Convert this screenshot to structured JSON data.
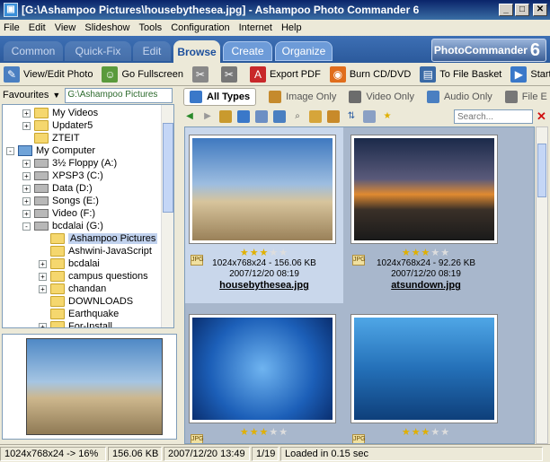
{
  "window": {
    "title": "[G:\\Ashampoo Pictures\\housebythesea.jpg] - Ashampoo Photo Commander 6",
    "minimize_glyph": "_",
    "maximize_glyph": "□",
    "close_glyph": "✕"
  },
  "menu": [
    "File",
    "Edit",
    "View",
    "Slideshow",
    "Tools",
    "Configuration",
    "Internet",
    "Help"
  ],
  "mode_tabs": [
    "Common",
    "Quick-Fix",
    "Edit",
    "Browse",
    "Create",
    "Organize"
  ],
  "brand": {
    "line1": "Ashampoo",
    "line2": "PhotoCommander",
    "version": "6"
  },
  "toolbar": {
    "view_edit": "View/Edit Photo",
    "fullscreen": "Go Fullscreen",
    "export_pdf": "Export PDF",
    "burn": "Burn CD/DVD",
    "file_basket": "To File Basket",
    "slideshow": "Start SlideSh"
  },
  "favourites": {
    "label": "Favourites",
    "path": "G:\\Ashampoo Pictures"
  },
  "tree": [
    {
      "label": "My Videos",
      "indent": 2,
      "expander": "+",
      "icon": "folder"
    },
    {
      "label": "Updater5",
      "indent": 2,
      "expander": "+",
      "icon": "folder"
    },
    {
      "label": "ZTEIT",
      "indent": 2,
      "expander": "",
      "icon": "folder"
    },
    {
      "label": "My Computer",
      "indent": 1,
      "expander": "-",
      "icon": "computer"
    },
    {
      "label": "3½ Floppy (A:)",
      "indent": 2,
      "expander": "+",
      "icon": "drive"
    },
    {
      "label": "XPSP3 (C:)",
      "indent": 2,
      "expander": "+",
      "icon": "drive"
    },
    {
      "label": "Data (D:)",
      "indent": 2,
      "expander": "+",
      "icon": "drive"
    },
    {
      "label": "Songs (E:)",
      "indent": 2,
      "expander": "+",
      "icon": "drive"
    },
    {
      "label": "Video (F:)",
      "indent": 2,
      "expander": "+",
      "icon": "drive"
    },
    {
      "label": "bcdalai (G:)",
      "indent": 2,
      "expander": "-",
      "icon": "drive"
    },
    {
      "label": "Ashampoo Pictures",
      "indent": 3,
      "expander": "",
      "icon": "folder",
      "selected": true
    },
    {
      "label": "Ashwini-JavaScript",
      "indent": 3,
      "expander": "",
      "icon": "folder"
    },
    {
      "label": "bcdalai",
      "indent": 3,
      "expander": "+",
      "icon": "folder"
    },
    {
      "label": "campus questions",
      "indent": 3,
      "expander": "+",
      "icon": "folder"
    },
    {
      "label": "chandan",
      "indent": 3,
      "expander": "+",
      "icon": "folder"
    },
    {
      "label": "DOWNLOADS",
      "indent": 3,
      "expander": "",
      "icon": "folder"
    },
    {
      "label": "Earthquake",
      "indent": 3,
      "expander": "",
      "icon": "folder"
    },
    {
      "label": "For-Install",
      "indent": 3,
      "expander": "+",
      "icon": "folder"
    }
  ],
  "filters": [
    "All Types",
    "Image Only",
    "Video Only",
    "Audio Only",
    "File E"
  ],
  "search": {
    "placeholder": "Search..."
  },
  "thumbnails": [
    {
      "dims": "1024x768x24 - 156.06 KB",
      "date": "2007/12/20 08:19",
      "name": "housebythesea.jpg",
      "rating": 3,
      "badge": "JPG",
      "selected": true
    },
    {
      "dims": "1024x768x24 - 92.26 KB",
      "date": "2007/12/20 08:19",
      "name": "atsundown.jpg",
      "rating": 3,
      "badge": "JPG",
      "selected": false
    },
    {
      "dims": "",
      "date": "",
      "name": "",
      "rating": 3,
      "badge": "JPG",
      "selected": false
    },
    {
      "dims": "",
      "date": "",
      "name": "",
      "rating": 3,
      "badge": "JPG",
      "selected": false
    }
  ],
  "status": {
    "dims": "1024x768x24 -> 16%",
    "size": "156.06 KB",
    "date": "2007/12/20 13:49",
    "count": "1/19",
    "load": "Loaded in 0.15 sec"
  }
}
